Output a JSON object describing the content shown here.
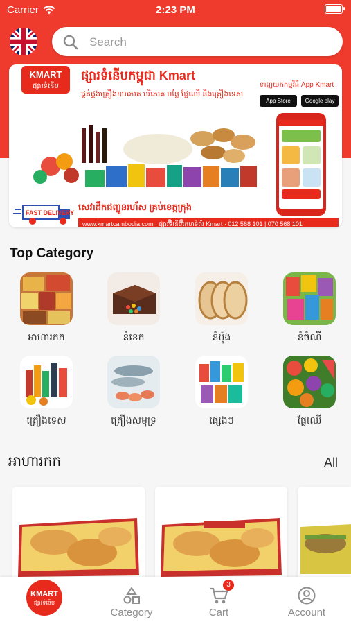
{
  "status_bar": {
    "carrier": "Carrier",
    "time": "2:23 PM"
  },
  "search": {
    "placeholder": "Search"
  },
  "banner": {
    "logo_line1": "KMART",
    "logo_line2": "ផ្សារទំនើប",
    "title": "ផ្សារទំនើបកម្ពុជា Kmart",
    "subtitle": "ផ្គត់ផ្គង់គ្រឿងឧបភោគ បរិភោគ បន្លែ ផ្លែឈើ និងគ្រឿងទេស",
    "app_text": "ទាញយកកម្មវិធី App Kmart",
    "app_store": "App Store",
    "google_play": "Google play",
    "fast_delivery": "FAST DELIVERY",
    "promo": "សេវាដឹកជញ្ជូនរហ័ស គ្រប់ខេត្តក្រុង",
    "footer": "www.kmartcambodia.com  ·  ផ្សារទំនើបគេហទំព័រ Kmart  ·  012 568 101 | 070 568 101"
  },
  "top_category": {
    "title": "Top Category",
    "items": [
      {
        "label": "អាហារកក"
      },
      {
        "label": "នំខេក"
      },
      {
        "label": "នំប៉័ង"
      },
      {
        "label": "នំចំណី"
      },
      {
        "label": "គ្រឿងទេស"
      },
      {
        "label": "គ្រឿងសមុទ្រ"
      },
      {
        "label": "ផ្សេងៗ"
      },
      {
        "label": "ផ្លែឈើ"
      }
    ]
  },
  "frozen_section": {
    "title": "អាហារកក",
    "all_label": "All"
  },
  "tabbar": {
    "home_line1": "KMART",
    "home_line2": "ផ្សារទំនើប",
    "category": "Category",
    "cart": "Cart",
    "cart_badge": "3",
    "account": "Account"
  },
  "colors": {
    "brand_red": "#ee3b2e",
    "tab_inactive": "#8e8e8e"
  }
}
